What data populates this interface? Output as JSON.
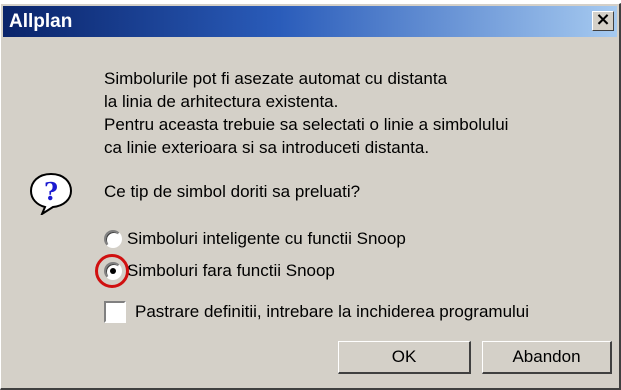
{
  "window": {
    "title": "Allplan",
    "close_glyph": "×"
  },
  "message": {
    "lines": [
      "Simbolurile pot fi asezate automat cu distanta",
      "la linia de arhitectura existenta.",
      "Pentru aceasta trebuie sa selectati o linie a simbolului",
      "ca linie exterioara si sa introduceti distanta."
    ],
    "question": "Ce tip de simbol doriti sa preluati?"
  },
  "options": [
    {
      "label": "Simboluri inteligente cu functii Snoop",
      "selected": false
    },
    {
      "label": "Simboluri fara functii Snoop",
      "selected": true
    }
  ],
  "checkbox": {
    "label": "Pastrare definitii, intrebare la inchiderea programului",
    "checked": false
  },
  "buttons": {
    "ok": "OK",
    "cancel": "Abandon"
  },
  "icons": {
    "dialog_icon": "question-icon"
  },
  "colors": {
    "titlebar_start": "#0a246a",
    "titlebar_end": "#a6caf0",
    "dialog_bg": "#d4d0c8",
    "highlight_ring": "#d01010"
  }
}
